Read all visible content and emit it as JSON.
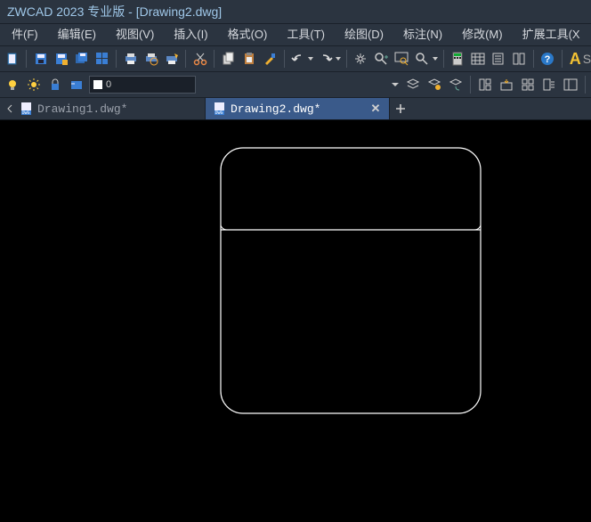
{
  "title": "ZWCAD 2023 专业版 - [Drawing2.dwg]",
  "menu": {
    "file": "件(F)",
    "edit": "编辑(E)",
    "view": "视图(V)",
    "insert": "插入(I)",
    "format": "格式(O)",
    "tools": "工具(T)",
    "draw": "绘图(D)",
    "annotate": "标注(N)",
    "modify": "修改(M)",
    "ext": "扩展工具(X"
  },
  "layer": {
    "current": "0"
  },
  "tabs": {
    "t1": "Drawing1.dwg*",
    "t2": "Drawing2.dwg*"
  }
}
